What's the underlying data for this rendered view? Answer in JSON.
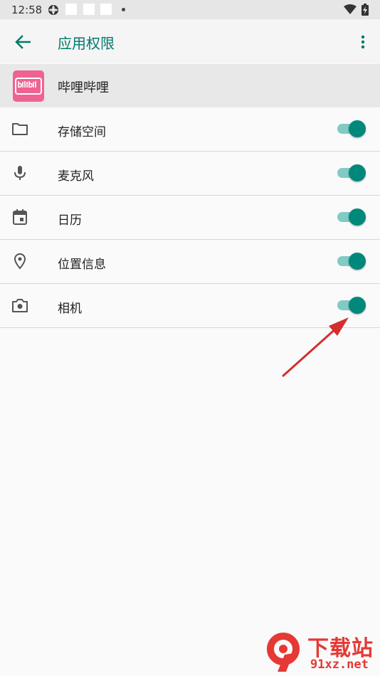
{
  "status_bar": {
    "time": "12:58"
  },
  "app_bar": {
    "title": "应用权限"
  },
  "app": {
    "name": "哔哩哔哩"
  },
  "permissions": [
    {
      "label": "存储空间",
      "icon": "folder-icon",
      "enabled": true
    },
    {
      "label": "麦克风",
      "icon": "microphone-icon",
      "enabled": true
    },
    {
      "label": "日历",
      "icon": "calendar-icon",
      "enabled": true
    },
    {
      "label": "位置信息",
      "icon": "location-pin-icon",
      "enabled": true
    },
    {
      "label": "相机",
      "icon": "camera-icon",
      "enabled": true
    }
  ],
  "colors": {
    "accent": "#00796b",
    "toggle_thumb": "#00897b",
    "toggle_track": "#80cbc4",
    "annotation_arrow": "#d32f2f"
  },
  "watermark": {
    "text_cn": "下载站",
    "text_en": "91xz.net"
  }
}
